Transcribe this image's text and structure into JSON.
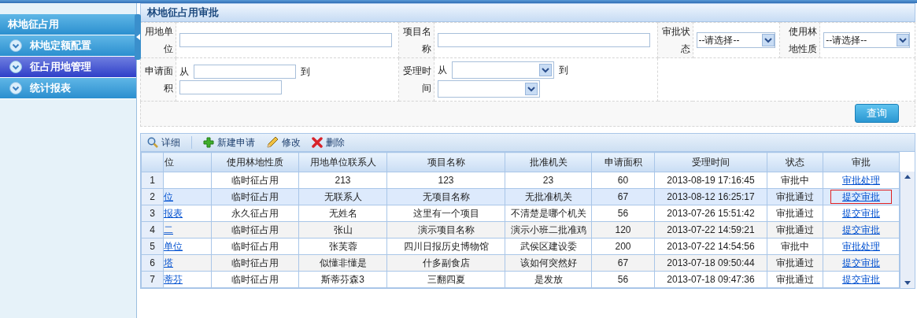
{
  "sidebar": {
    "title": "林地征占用",
    "items": [
      {
        "label": "林地定额配置",
        "selected": false
      },
      {
        "label": "征占用地管理",
        "selected": true
      },
      {
        "label": "统计报表",
        "selected": false
      }
    ]
  },
  "panel": {
    "title": "林地征占用审批"
  },
  "filters": {
    "unit": {
      "label": "用地单位"
    },
    "project": {
      "label": "项目名称"
    },
    "status": {
      "label": "审批状态",
      "value": "--请选择--"
    },
    "nature": {
      "label": "使用林地性质",
      "value": "--请选择--"
    },
    "area": {
      "label": "申请面积",
      "from": "从",
      "to": "到"
    },
    "time": {
      "label": "受理时间",
      "from": "从",
      "to": "到"
    },
    "search_button": "查询"
  },
  "toolbar": [
    {
      "kind": "detail",
      "label": "详细"
    },
    {
      "kind": "add",
      "label": "新建申请"
    },
    {
      "kind": "edit",
      "label": "修改"
    },
    {
      "kind": "delete",
      "label": "删除"
    }
  ],
  "table": {
    "columns": [
      "位",
      "使用林地性质",
      "用地单位联系人",
      "项目名称",
      "批准机关",
      "申请面积",
      "受理时间",
      "状态",
      "审批"
    ],
    "rows": [
      {
        "num": "1",
        "unit": "",
        "nature": "临时征占用",
        "contact": "213",
        "project": "123",
        "authority": "23",
        "area": "60",
        "time": "2013-08-19 17:16:45",
        "status": "审批中",
        "action": "审批处理",
        "selected": false
      },
      {
        "num": "2",
        "unit": "位",
        "nature": "临时征占用",
        "contact": "无联系人",
        "project": "无项目名称",
        "authority": "无批准机关",
        "area": "67",
        "time": "2013-08-12 16:25:17",
        "status": "审批通过",
        "action": "提交审批",
        "selected": true
      },
      {
        "num": "3",
        "unit": "报表",
        "nature": "永久征占用",
        "contact": "无姓名",
        "project": "这里有一个项目",
        "authority": "不清楚是哪个机关",
        "area": "56",
        "time": "2013-07-26 15:51:42",
        "status": "审批通过",
        "action": "提交审批",
        "selected": false
      },
      {
        "num": "4",
        "unit": "二",
        "nature": "临时征占用",
        "contact": "张山",
        "project": "演示项目名称",
        "authority": "演示小班二批准鸡",
        "area": "120",
        "time": "2013-07-22 14:59:21",
        "status": "审批通过",
        "action": "提交审批",
        "selected": false
      },
      {
        "num": "5",
        "unit": "单位",
        "nature": "临时征占用",
        "contact": "张芙蓉",
        "project": "四川日报历史博物馆",
        "authority": "武侯区建设委",
        "area": "200",
        "time": "2013-07-22 14:54:56",
        "status": "审批中",
        "action": "审批处理",
        "selected": false
      },
      {
        "num": "6",
        "unit": "塔",
        "nature": "临时征占用",
        "contact": "似懂非懂是",
        "project": "什多副食店",
        "authority": "该如何突然好",
        "area": "67",
        "time": "2013-07-18 09:50:44",
        "status": "审批通过",
        "action": "提交审批",
        "selected": false
      },
      {
        "num": "7",
        "unit": "蒂芬",
        "nature": "临时征占用",
        "contact": "斯蒂芬森3",
        "project": "三翻四夏",
        "authority": "是发放",
        "area": "56",
        "time": "2013-07-18 09:47:36",
        "status": "审批通过",
        "action": "提交审批",
        "selected": false
      }
    ]
  }
}
